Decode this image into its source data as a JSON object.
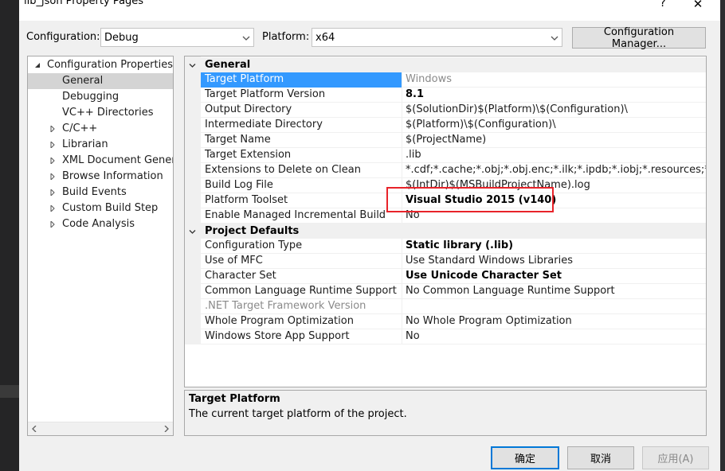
{
  "window": {
    "title": "lib_json Property Pages",
    "help": "?",
    "close": "✕"
  },
  "toolbar": {
    "configuration_label": "Configuration:",
    "configuration_value": "Debug",
    "platform_label": "Platform:",
    "platform_value": "x64",
    "config_manager_button": "Configuration Manager..."
  },
  "tree": {
    "root": "Configuration Properties",
    "items": [
      {
        "label": "General",
        "selected": true,
        "expandable": false
      },
      {
        "label": "Debugging",
        "expandable": false
      },
      {
        "label": "VC++ Directories",
        "expandable": false
      },
      {
        "label": "C/C++",
        "expandable": true
      },
      {
        "label": "Librarian",
        "expandable": true
      },
      {
        "label": "XML Document Generat",
        "expandable": true
      },
      {
        "label": "Browse Information",
        "expandable": true
      },
      {
        "label": "Build Events",
        "expandable": true
      },
      {
        "label": "Custom Build Step",
        "expandable": true
      },
      {
        "label": "Code Analysis",
        "expandable": true
      }
    ]
  },
  "grid": {
    "categories": [
      {
        "name": "General",
        "rows": [
          {
            "name": "Target Platform",
            "value": "Windows",
            "selected": true,
            "value_gray": true
          },
          {
            "name": "Target Platform Version",
            "value": "8.1",
            "bold": true
          },
          {
            "name": "Output Directory",
            "value": "$(SolutionDir)$(Platform)\\$(Configuration)\\"
          },
          {
            "name": "Intermediate Directory",
            "value": "$(Platform)\\$(Configuration)\\"
          },
          {
            "name": "Target Name",
            "value": "$(ProjectName)"
          },
          {
            "name": "Target Extension",
            "value": ".lib"
          },
          {
            "name": "Extensions to Delete on Clean",
            "value": "*.cdf;*.cache;*.obj;*.obj.enc;*.ilk;*.ipdb;*.iobj;*.resources;*.tlb;*.tli;*.t"
          },
          {
            "name": "Build Log File",
            "value": "$(IntDir)$(MSBuildProjectName).log"
          },
          {
            "name": "Platform Toolset",
            "value": "Visual Studio 2015 (v140)",
            "bold": true
          },
          {
            "name": "Enable Managed Incremental Build",
            "value": "No"
          }
        ]
      },
      {
        "name": "Project Defaults",
        "rows": [
          {
            "name": "Configuration Type",
            "value": "Static library (.lib)",
            "bold": true
          },
          {
            "name": "Use of MFC",
            "value": "Use Standard Windows Libraries"
          },
          {
            "name": "Character Set",
            "value": "Use Unicode Character Set",
            "bold": true
          },
          {
            "name": "Common Language Runtime Support",
            "value": "No Common Language Runtime Support"
          },
          {
            "name": ".NET Target Framework Version",
            "value": "",
            "name_gray": true
          },
          {
            "name": "Whole Program Optimization",
            "value": "No Whole Program Optimization"
          },
          {
            "name": "Windows Store App Support",
            "value": "No"
          }
        ]
      }
    ]
  },
  "description": {
    "title": "Target Platform",
    "text": "The current target platform of the project."
  },
  "buttons": {
    "ok": "确定",
    "cancel": "取消",
    "apply": "应用(A)"
  },
  "colors": {
    "selection": "#3399ff",
    "highlight_box": "#e8232a"
  }
}
